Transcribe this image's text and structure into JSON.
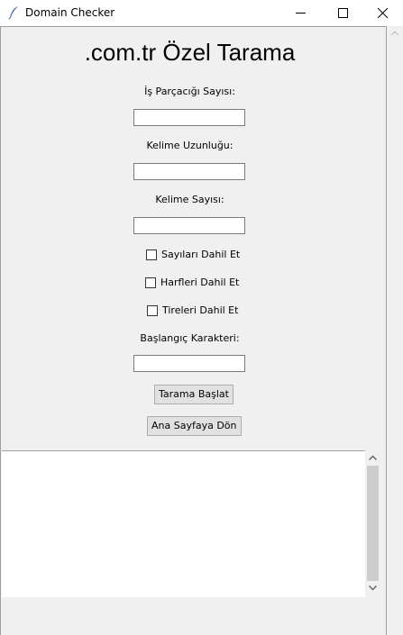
{
  "window": {
    "title": "Domain Checker"
  },
  "main": {
    "title": ".com.tr Özel Tarama",
    "fields": [
      {
        "label": "İş Parçacığı Sayısı:",
        "value": ""
      },
      {
        "label": "Kelime Uzunluğu:",
        "value": ""
      },
      {
        "label": "Kelime Sayısı:",
        "value": ""
      }
    ],
    "checkboxes": [
      {
        "label": "Sayıları Dahil Et",
        "checked": false
      },
      {
        "label": "Harfleri Dahil Et",
        "checked": false
      },
      {
        "label": "Tireleri Dahil Et",
        "checked": false
      }
    ],
    "start_char": {
      "label": "Başlangıç Karakteri:",
      "value": ""
    },
    "buttons": {
      "start": "Tarama Başlat",
      "home": "Ana Sayfaya Dön"
    },
    "output_text": ""
  }
}
